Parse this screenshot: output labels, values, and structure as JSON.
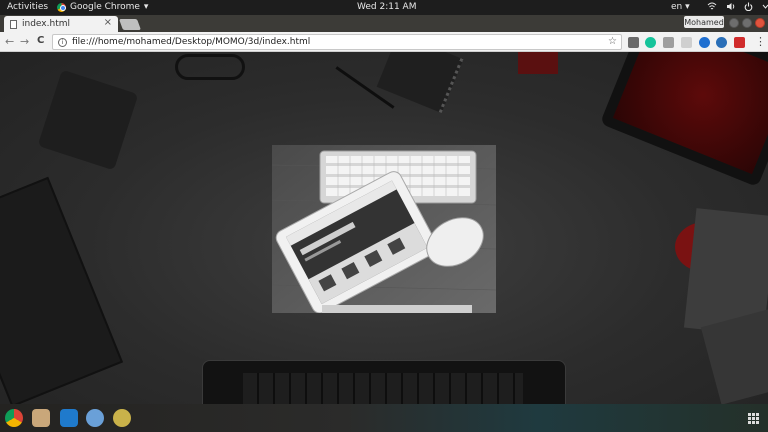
{
  "topbar": {
    "activities": "Activities",
    "app_name": "Google Chrome",
    "app_menu_arrow": "▾",
    "clock": "Wed  2:11 AM",
    "language": "en",
    "language_arrow": "▾"
  },
  "browser": {
    "tab_title": "index.html",
    "tab_close": "×",
    "profile_name": "Mohamed",
    "url": "file:///home/mohamed/Desktop/MOMO/3d/index.html",
    "star": "☆",
    "menu": "⋮",
    "back": "←",
    "forward": "→",
    "reload": "C",
    "info_glyph": "i"
  },
  "extensions": [
    {
      "name": "skype-extension-icon",
      "color": "#6a6a6a"
    },
    {
      "name": "grammarly-extension-icon",
      "color": "#15c39a"
    },
    {
      "name": "extension-icon-3",
      "color": "#9e9e9e"
    },
    {
      "name": "extension-icon-4",
      "color": "#cfcfcf"
    },
    {
      "name": "steem-extension-icon",
      "color": "#1f6fd0"
    },
    {
      "name": "extension-icon-6",
      "color": "#2a6fb8"
    },
    {
      "name": "badge-extension-icon",
      "color": "#d02b2b",
      "badge": "1.0"
    }
  ],
  "dock": [
    {
      "name": "chrome-dock-icon",
      "color": "#db4437"
    },
    {
      "name": "files-dock-icon",
      "color": "#c9a77a"
    },
    {
      "name": "vscode-dock-icon",
      "color": "#1f7acc"
    },
    {
      "name": "globe-dock-icon",
      "color": "#6aa0d8"
    },
    {
      "name": "app-dock-icon",
      "color": "#c9b24a"
    }
  ]
}
